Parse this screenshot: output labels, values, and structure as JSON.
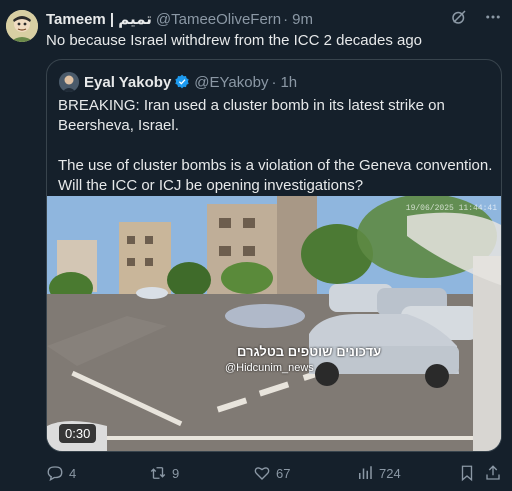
{
  "tweet": {
    "author_name": "Tameem | تميم",
    "handle": "@TameeOliveFern",
    "separator": "·",
    "time": "9m",
    "text": "No because Israel withdrew from the ICC 2 decades ago"
  },
  "quote": {
    "author_name": "Eyal Yakoby",
    "handle": "@EYakoby",
    "separator": "·",
    "time": "1h",
    "text": "BREAKING: Iran used a cluster bomb in its latest strike on Beersheva, Israel.\n\nThe use of cluster bombs is a violation of the Geneva convention. Will the ICC or ICJ be opening investigations?",
    "media": {
      "duration": "0:30",
      "overlay_text": "עדכונים שוטפים בטלגרם",
      "overlay_handle": "@Hidcunim_news",
      "camera_timestamp": "19/06/2025 11:44:41"
    }
  },
  "actions": {
    "replies": "4",
    "reposts": "9",
    "likes": "67",
    "views": "724"
  },
  "icons": {
    "grok": "grok-icon",
    "more": "more-icon",
    "reply": "reply-icon",
    "repost": "repost-icon",
    "like": "like-icon",
    "views": "views-icon",
    "bookmark": "bookmark-icon",
    "share": "share-icon"
  },
  "colors": {
    "background": "#15202b",
    "border": "#38444d",
    "muted": "#8b98a5",
    "verified": "#1d9bf0"
  }
}
